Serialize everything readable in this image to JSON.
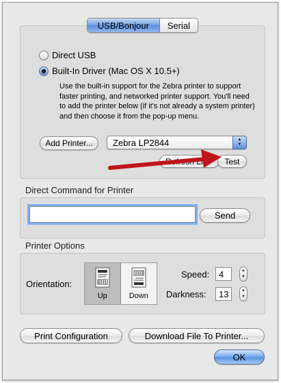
{
  "tabs": [
    {
      "label": "USB/Bonjour",
      "selected": true
    },
    {
      "label": "Serial",
      "selected": false
    }
  ],
  "connection": {
    "direct_usb_label": "Direct USB",
    "builtin_driver_label": "Built-In Driver (Mac OS X 10.5+)",
    "selected": "builtin",
    "description": "Use the built-in support for the Zebra printer to support faster printing, and networked printer support. You'll need to add the printer below (if it's not already a system printer) and then choose it from the pop-up menu.",
    "add_printer_label": "Add Printer...",
    "printer_selected": "Zebra LP2844",
    "refresh_label": "Refresh List",
    "test_label": "Test"
  },
  "direct_command": {
    "section_label": "Direct Command for Printer",
    "input_value": "",
    "send_label": "Send"
  },
  "printer_options": {
    "section_label": "Printer Options",
    "orientation_label": "Orientation:",
    "orientation_options": [
      {
        "label": "Up",
        "selected": true
      },
      {
        "label": "Down",
        "selected": false
      }
    ],
    "speed_label": "Speed:",
    "speed_value": "4",
    "darkness_label": "Darkness:",
    "darkness_value": "13"
  },
  "footer": {
    "print_config_label": "Print Configuration",
    "download_label": "Download File To Printer...",
    "ok_label": "OK"
  },
  "colors": {
    "annotation_arrow": "#c0141c",
    "focus_ring": "#7eaef0"
  }
}
